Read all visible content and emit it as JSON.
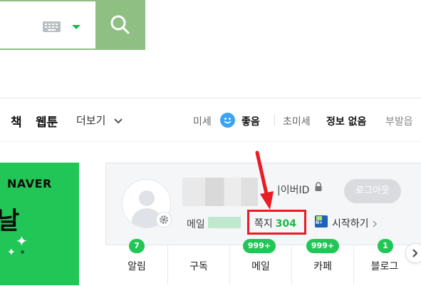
{
  "nav": {
    "items": [
      "책",
      "웹툰"
    ],
    "more_label": "더보기"
  },
  "weather": {
    "fine_dust_label": "미세",
    "fine_dust_status": "좋음",
    "ultrafine_dust_label": "초미세",
    "ultrafine_dust_status": "정보 없음",
    "next_label": "부발읍"
  },
  "banner": {
    "logo_text": "NAVER",
    "glyph": "날"
  },
  "account": {
    "naver_id_label": "|이버ID",
    "logout_label": "로그아웃",
    "mail_label": "메일",
    "note_label": "쪽지",
    "note_count": "304",
    "pay_icon_text": "N+",
    "start_label": "시작하기"
  },
  "tabs": [
    {
      "label": "알림",
      "badge": "7"
    },
    {
      "label": "구독",
      "badge": ""
    },
    {
      "label": "메일",
      "badge": "999+"
    },
    {
      "label": "카페",
      "badge": "999+"
    },
    {
      "label": "블로그",
      "badge": "1"
    }
  ],
  "colors": {
    "search_green": "#8fbf83",
    "naver_green": "#22c657",
    "highlight_red": "#ea1c24"
  },
  "icons": [
    "keyboard-icon",
    "caret-down-icon",
    "search-icon",
    "chevron-down-icon",
    "smile-icon",
    "gear-icon",
    "lock-icon",
    "naver-pay-icon",
    "chevron-right-icon"
  ]
}
